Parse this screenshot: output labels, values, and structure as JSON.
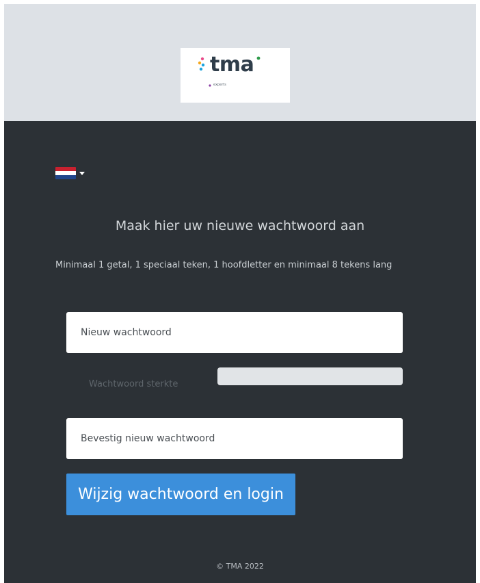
{
  "header": {
    "logo": {
      "wordmark": "tma",
      "tagline": "experts",
      "dot_colors": [
        "#e94b8a",
        "#f4a81d",
        "#1aa3dd",
        "#2e9b4a",
        "#8c3fa5"
      ],
      "text_color": "#2f3d4a"
    }
  },
  "language": {
    "icon": "netherlands-flag-icon",
    "selected": "nl"
  },
  "form": {
    "title": "Maak hier uw nieuwe wachtwoord aan",
    "requirements": "Minimaal 1 getal, 1 speciaal teken, 1 hoofdletter en minimaal 8 tekens lang",
    "new_password": {
      "placeholder": "Nieuw wachtwoord",
      "value": ""
    },
    "strength": {
      "label": "Wachtwoord sterkte",
      "level": 0
    },
    "confirm_password": {
      "placeholder": "Bevestig nieuw wachtwoord",
      "value": ""
    },
    "submit_label": "Wijzig wachtwoord en login"
  },
  "footer": {
    "copyright": "© TMA 2022"
  },
  "colors": {
    "header_bg": "#dde1e6",
    "panel_bg": "#2c3136",
    "accent": "#3c8fdb"
  }
}
